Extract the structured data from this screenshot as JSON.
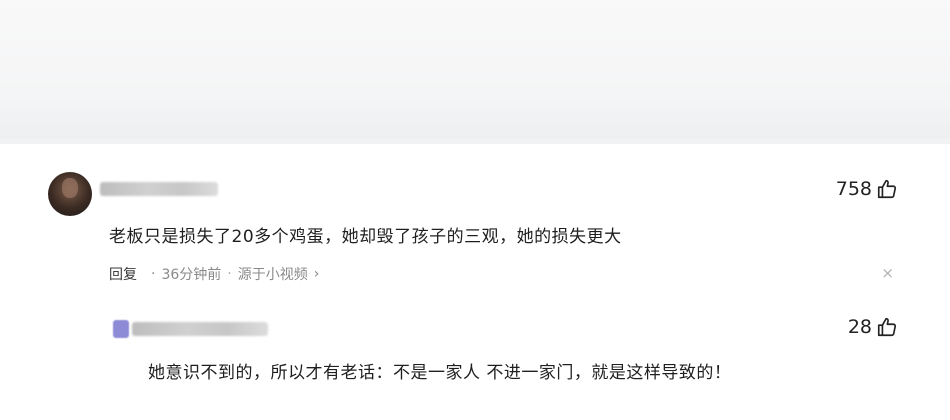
{
  "comment": {
    "likes": "758",
    "text": "老板只是损失了20多个鸡蛋，她却毁了孩子的三观，她的损失更大",
    "reply_label": "回复",
    "time": "36分钟前",
    "dot": "·",
    "source": "源于小视频",
    "chevron": "›",
    "close": "×"
  },
  "reply": {
    "likes": "28",
    "text": "她意识不到的，所以才有老话：不是一家人 不进一家门，就是这样导致的！"
  },
  "icons": {
    "like": "thumbs-up-icon",
    "close": "close-icon",
    "chevron": "chevron-right-icon"
  }
}
